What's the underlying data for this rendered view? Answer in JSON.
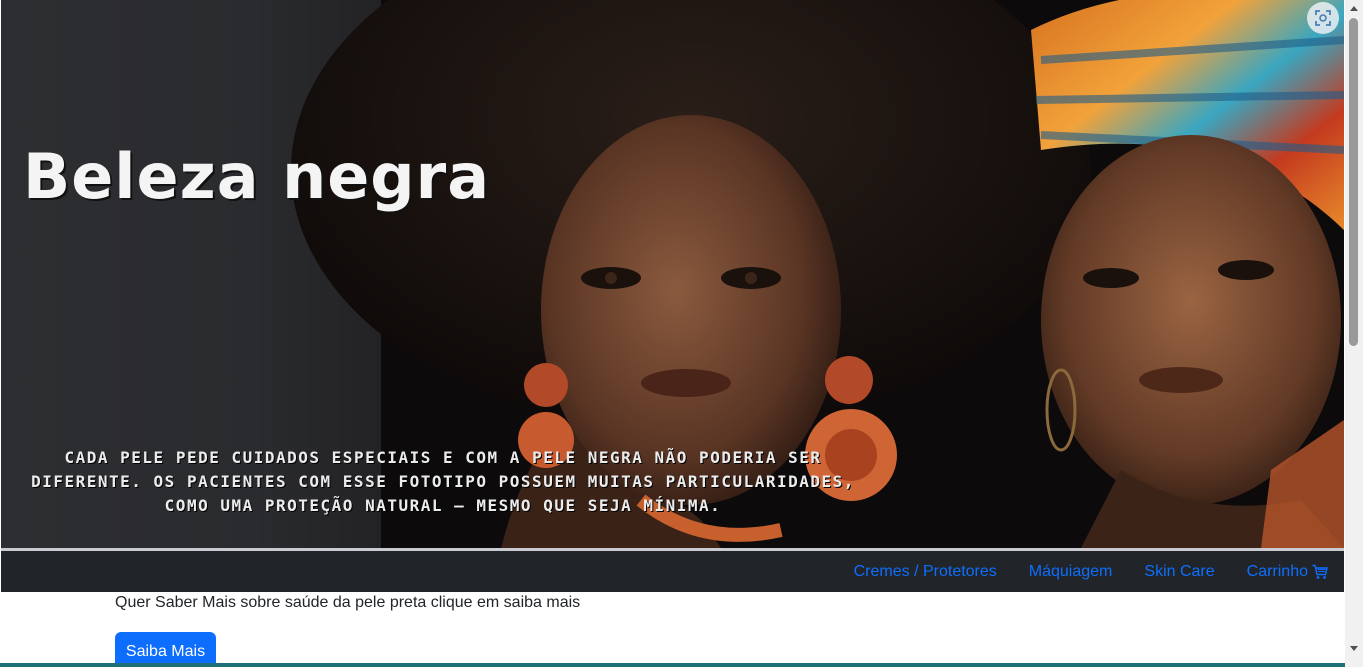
{
  "banner": {
    "title": "Beleza negra",
    "caption": "Cada pele pede cuidados especiais e com a pele negra não poderia ser diferente. Os pacientes com esse fototipo possuem muitas particularidades, como uma proteção natural – mesmo que seja mínima.",
    "corner_icon": "screenshot-capture-icon"
  },
  "navbar": {
    "links": [
      {
        "label": "Cremes / Protetores"
      },
      {
        "label": "Máquiagem"
      },
      {
        "label": "Skin Care"
      },
      {
        "label": "Carrinho",
        "icon": "cart-icon"
      }
    ]
  },
  "content": {
    "text": "Quer Saber Mais sobre saúde da pele preta clique em saiba mais",
    "button_label": "Saiba Mais"
  },
  "colors": {
    "navbar_bg": "#212529",
    "link": "#0d6efd",
    "button_bg": "#0d6efd"
  }
}
